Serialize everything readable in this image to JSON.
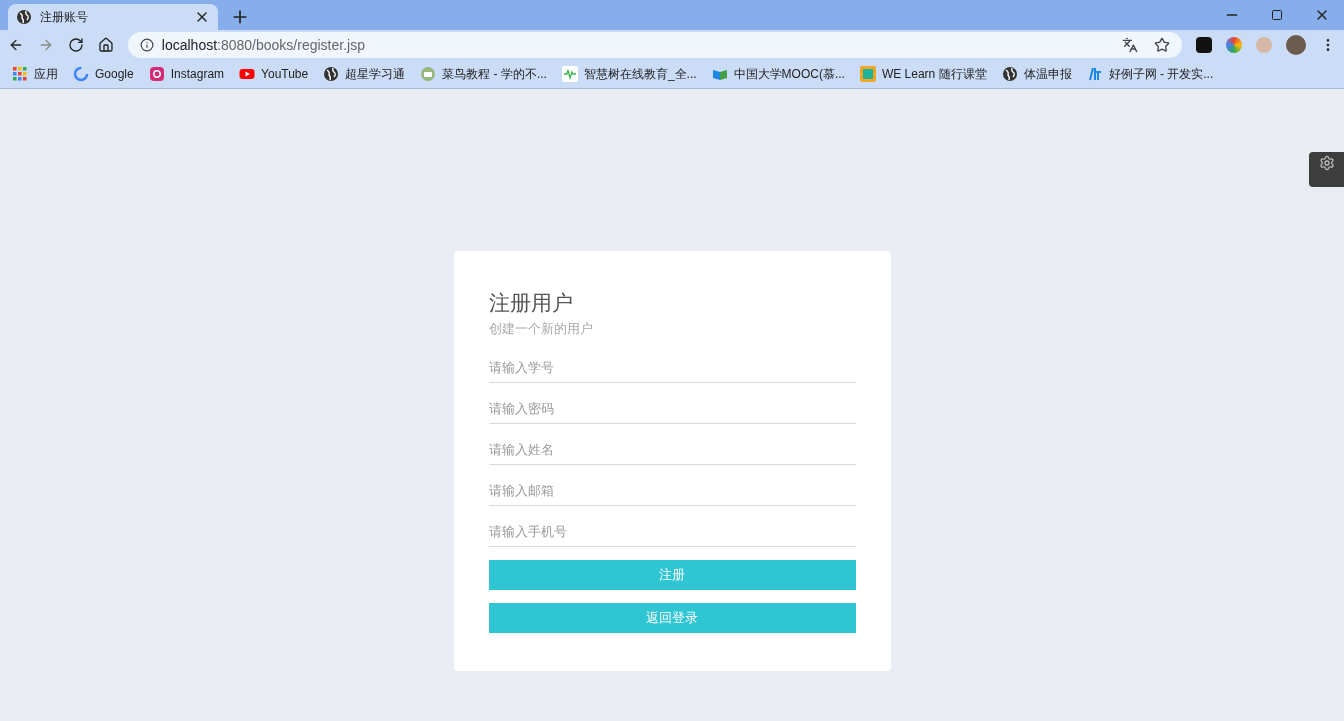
{
  "tab": {
    "title": "注册账号",
    "selected": true
  },
  "address": {
    "host": "localhost",
    "rest": ":8080/books/register.jsp"
  },
  "bookmarks": [
    {
      "kind": "apps",
      "label": "应用"
    },
    {
      "kind": "google",
      "label": "Google"
    },
    {
      "kind": "instagram",
      "label": "Instagram"
    },
    {
      "kind": "youtube",
      "label": "YouTube"
    },
    {
      "kind": "globe",
      "label": "超星学习通"
    },
    {
      "kind": "runoob",
      "label": "菜鸟教程 - 学的不..."
    },
    {
      "kind": "zhs",
      "label": "智慧树在线教育_全..."
    },
    {
      "kind": "mooc",
      "label": "中国大学MOOC(慕..."
    },
    {
      "kind": "welearn",
      "label": "WE Learn 随行课堂"
    },
    {
      "kind": "globe",
      "label": "体温申报"
    },
    {
      "kind": "example",
      "label": "好例子网 - 开发实..."
    }
  ],
  "form": {
    "title": "注册用户",
    "subtitle": "创建一个新的用户",
    "fields": [
      {
        "placeholder": "请输入学号"
      },
      {
        "placeholder": "请输入密码"
      },
      {
        "placeholder": "请输入姓名"
      },
      {
        "placeholder": "请输入邮箱"
      },
      {
        "placeholder": "请输入手机号"
      }
    ],
    "buttons": [
      "注册",
      "返回登录"
    ]
  }
}
